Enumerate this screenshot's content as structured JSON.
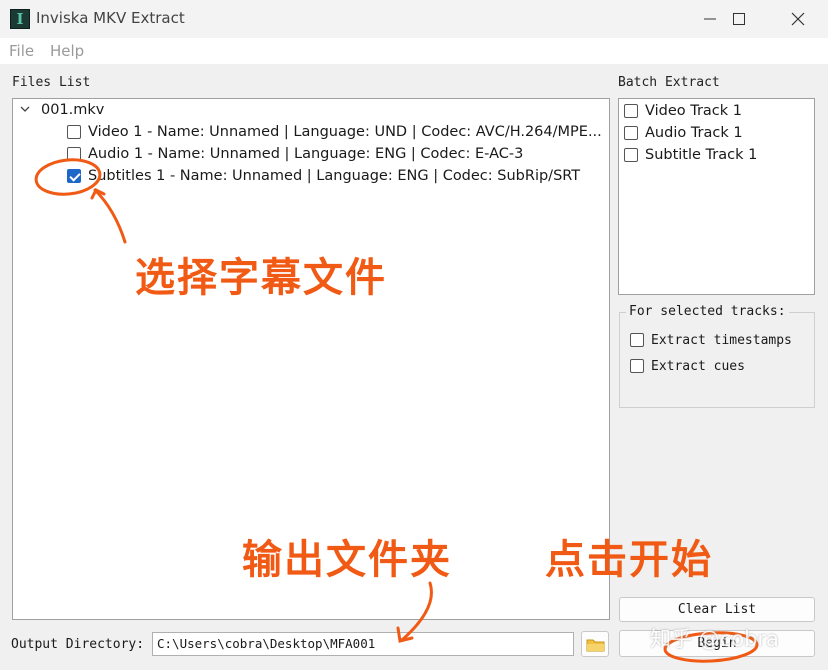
{
  "window": {
    "title": "Inviska MKV Extract",
    "app_icon_glyph": "I"
  },
  "menu": [
    "File",
    "Help"
  ],
  "files_list": {
    "label": "Files List",
    "root": "001.mkv",
    "tracks": [
      {
        "text": "Video 1 - Name: Unnamed | Language: UND | Codec: AVC/H.264/MPE...",
        "checked": false
      },
      {
        "text": "Audio 1 - Name: Unnamed | Language: ENG | Codec: E-AC-3",
        "checked": false
      },
      {
        "text": "Subtitles 1 - Name: Unnamed | Language: ENG | Codec: SubRip/SRT",
        "checked": true
      }
    ]
  },
  "batch": {
    "label": "Batch Extract",
    "items": [
      "Video Track 1",
      "Audio Track 1",
      "Subtitle Track 1"
    ]
  },
  "options": {
    "title": "For selected tracks:",
    "items": [
      "Extract timestamps",
      "Extract cues"
    ]
  },
  "output": {
    "label": "Output Directory:",
    "value": "C:\\Users\\cobra\\Desktop\\MFA001"
  },
  "buttons": {
    "clear": "Clear List",
    "begin": "Begin"
  },
  "annotations": {
    "select_subtitle": "选择字幕文件",
    "output_folder": "输出文件夹",
    "click_start": "点击开始"
  },
  "watermark": "知乎 @cobra",
  "colors": {
    "annotation": "#f05a14",
    "checkbox_checked": "#1f66c9"
  }
}
